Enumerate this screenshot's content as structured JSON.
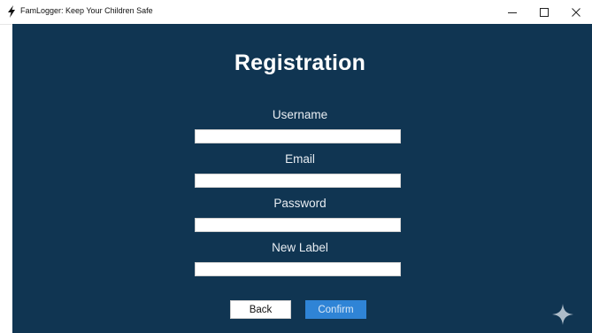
{
  "window": {
    "title": "FamLogger: Keep Your Children Safe",
    "app_icon": "feather-icon",
    "controls": [
      "minimize-icon",
      "maximize-icon",
      "close-icon"
    ]
  },
  "form": {
    "heading": "Registration",
    "fields": [
      {
        "label": "Username",
        "value": "",
        "placeholder": ""
      },
      {
        "label": "Email",
        "value": "",
        "placeholder": ""
      },
      {
        "label": "Password",
        "value": "",
        "placeholder": ""
      },
      {
        "label": "New Label",
        "value": "",
        "placeholder": ""
      }
    ],
    "buttons": {
      "back_label": "Back",
      "confirm_label": "Confirm"
    }
  },
  "decor": {
    "corner_icon": "sparkle-icon"
  },
  "colors": {
    "background": "#103552",
    "heading": "#ffffff",
    "confirm_button": "#2f84d6",
    "back_button": "#ffffff"
  }
}
